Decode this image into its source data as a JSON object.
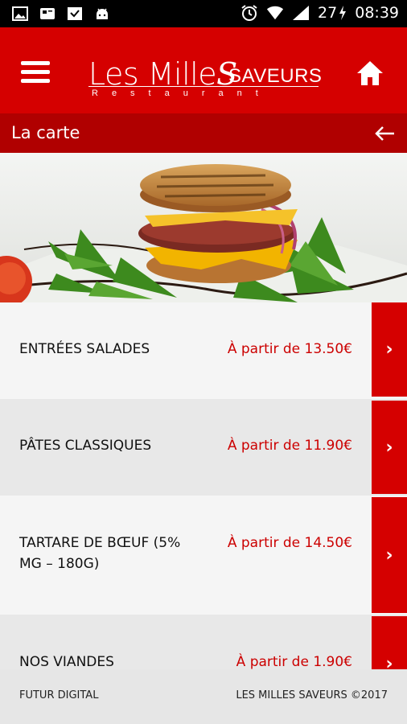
{
  "status_bar": {
    "left_icons": [
      "image-icon",
      "sim-card-icon",
      "inbox-icon",
      "android-icon"
    ],
    "right_icons": [
      "alarm-icon",
      "wifi-icon",
      "signal-icon"
    ],
    "battery": "27",
    "time": "08:39"
  },
  "header": {
    "logo_main": "Les Mille",
    "logo_s": "S",
    "logo_saveurs": "SAVEURS",
    "logo_sub": "Restaurant",
    "menu_icon": "hamburger-menu-icon",
    "home_icon": "home-icon",
    "bg_color": "#d50000"
  },
  "subheader": {
    "title": "La carte",
    "back_icon": "arrow-left-icon",
    "bg_color": "#b00000"
  },
  "menu": {
    "items": [
      {
        "label": "ENTRÉES SALADES",
        "price": "À partir de 13.50€"
      },
      {
        "label": "PÂTES CLASSIQUES",
        "price": "À partir de 11.90€"
      },
      {
        "label": "TARTARE DE BŒUF (5% MG – 180G)",
        "price": "À partir de 14.50€"
      },
      {
        "label": "NOS VIANDES",
        "price": "À partir de 1.90€"
      }
    ],
    "arrow_glyph": "›",
    "price_color": "#cc0000"
  },
  "footer": {
    "left": "FUTUR DIGITAL",
    "right": "LES MILLES SAVEURS ©2017"
  }
}
